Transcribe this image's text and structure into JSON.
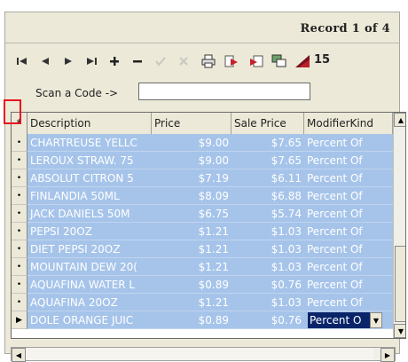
{
  "record": {
    "label": "Record",
    "current": "1",
    "of_label": "of",
    "total": "4"
  },
  "toolbar": {
    "first": "⏮",
    "prev": "◀",
    "next": "▶",
    "last": "⏭",
    "add": "+",
    "remove": "−",
    "accept": "✓",
    "cancel": "✕",
    "print": "🖶",
    "export": "➤",
    "import": "⇩",
    "refresh": "⟳",
    "chart": "◢",
    "count": "15"
  },
  "scan": {
    "label": "Scan a Code ->",
    "value": "",
    "placeholder": ""
  },
  "grid": {
    "header_corner": "*",
    "columns": [
      "Description",
      "Price",
      "Sale Price",
      "ModifierKind"
    ],
    "rows": [
      {
        "indicator": "•",
        "description": "CHARTREUSE YELLC",
        "price": "$9.00",
        "sale": "$7.65",
        "kind": "Percent Of"
      },
      {
        "indicator": "•",
        "description": "LEROUX STRAW. 75",
        "price": "$9.00",
        "sale": "$7.65",
        "kind": "Percent Of"
      },
      {
        "indicator": "•",
        "description": "ABSOLUT CITRON 5",
        "price": "$7.19",
        "sale": "$6.11",
        "kind": "Percent Of"
      },
      {
        "indicator": "•",
        "description": "FINLANDIA 50ML",
        "price": "$8.09",
        "sale": "$6.88",
        "kind": "Percent Of"
      },
      {
        "indicator": "•",
        "description": "JACK DANIELS 50M",
        "price": "$6.75",
        "sale": "$5.74",
        "kind": "Percent Of"
      },
      {
        "indicator": "•",
        "description": "PEPSI 20OZ",
        "price": "$1.21",
        "sale": "$1.03",
        "kind": "Percent Of"
      },
      {
        "indicator": "•",
        "description": "DIET PEPSI 20OZ",
        "price": "$1.21",
        "sale": "$1.03",
        "kind": "Percent Of"
      },
      {
        "indicator": "•",
        "description": "MOUNTAIN DEW 20(",
        "price": "$1.21",
        "sale": "$1.03",
        "kind": "Percent Of"
      },
      {
        "indicator": "•",
        "description": "AQUAFINA WATER L",
        "price": "$0.89",
        "sale": "$0.76",
        "kind": "Percent Of"
      },
      {
        "indicator": "•",
        "description": "AQUAFINA 20OZ",
        "price": "$1.21",
        "sale": "$1.03",
        "kind": "Percent Of"
      },
      {
        "indicator": "▶",
        "description": "DOLE ORANGE JUIC",
        "price": "$0.89",
        "sale": "$0.76",
        "kind": "Percent O"
      }
    ]
  },
  "colors": {
    "row_bg": "#a6c4ea",
    "active_edit": "#0a246a",
    "highlight": "#e8141e"
  }
}
